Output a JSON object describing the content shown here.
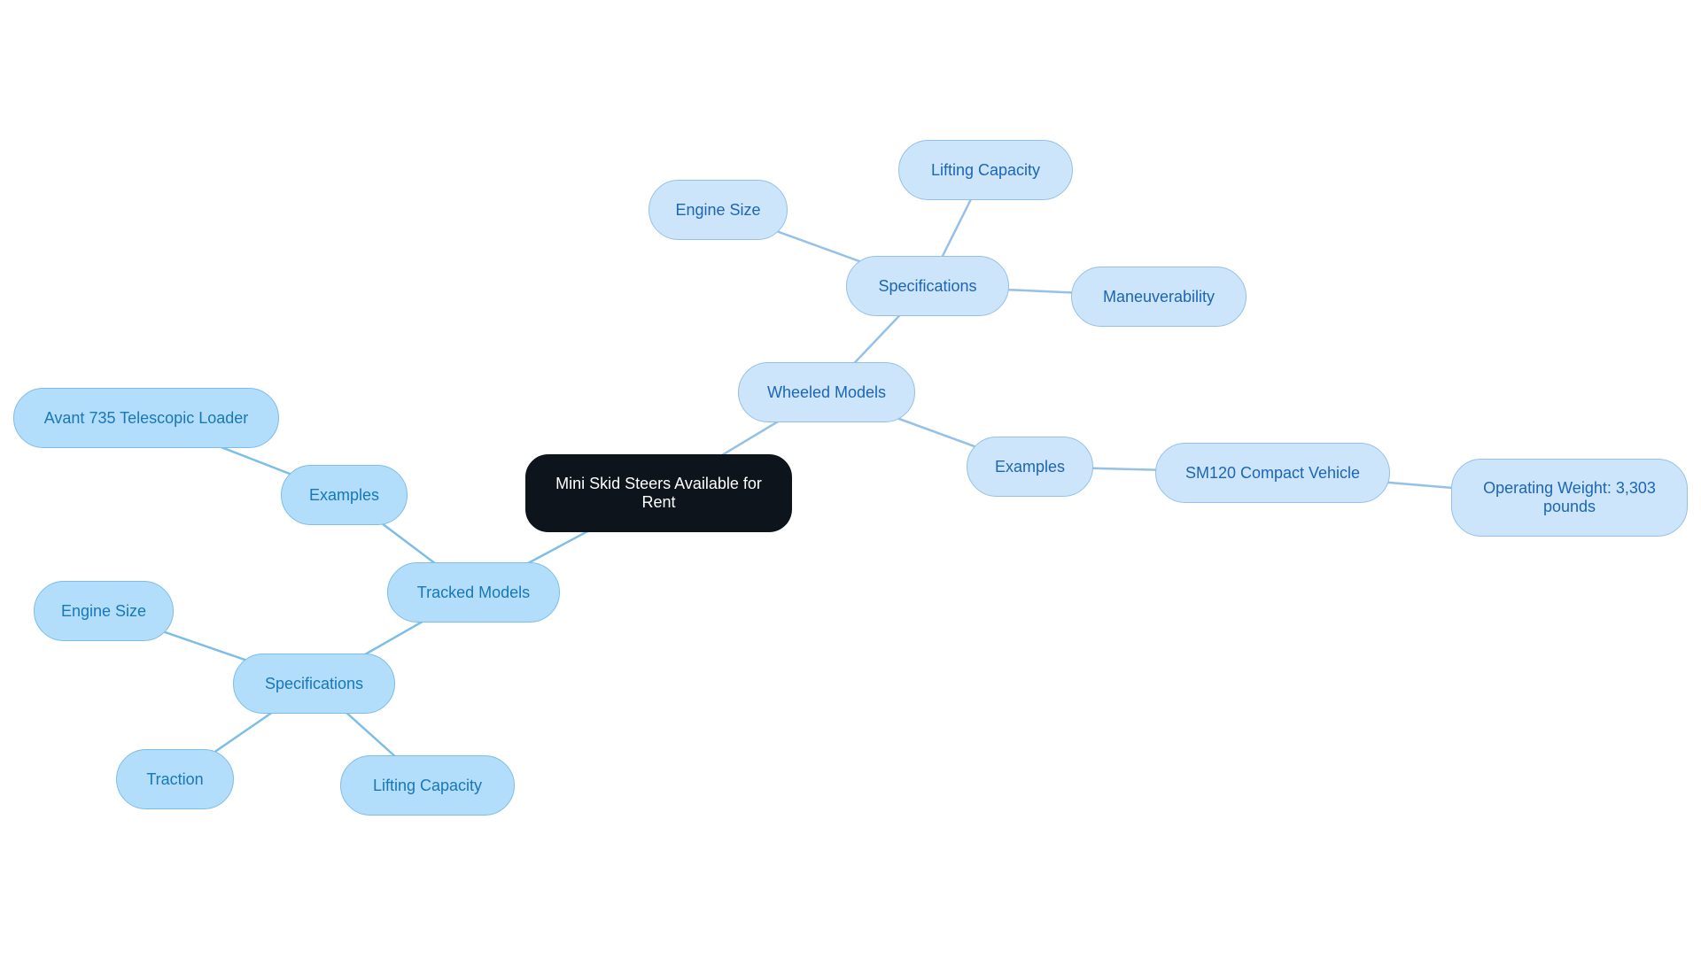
{
  "diagram": {
    "type": "mind-map",
    "colors": {
      "root_fill": "#0d141b",
      "root_text": "#ffffff",
      "wheeled_fill": "#cde5fb",
      "wheeled_text": "#1c66b4",
      "wheeled_edge": "#95c0e8",
      "tracked_fill": "#b3defb",
      "tracked_text": "#1877b6",
      "tracked_edge": "#7dbde6"
    },
    "root": {
      "label": "Mini Skid Steers Available for Rent"
    },
    "nodes": {
      "wheeled": {
        "label": "Wheeled Models"
      },
      "wheeled_specs": {
        "label": "Specifications"
      },
      "wheeled_engine": {
        "label": "Engine Size"
      },
      "wheeled_lifting": {
        "label": "Lifting Capacity"
      },
      "wheeled_maneuver": {
        "label": "Maneuverability"
      },
      "wheeled_examples": {
        "label": "Examples"
      },
      "sm120": {
        "label": "SM120 Compact Vehicle"
      },
      "sm120_weight": {
        "label": "Operating Weight: 3,303 pounds"
      },
      "tracked": {
        "label": "Tracked Models"
      },
      "tracked_examples": {
        "label": "Examples"
      },
      "avant": {
        "label": "Avant 735 Telescopic Loader"
      },
      "tracked_specs": {
        "label": "Specifications"
      },
      "tracked_engine": {
        "label": "Engine Size"
      },
      "tracked_traction": {
        "label": "Traction"
      },
      "tracked_lifting": {
        "label": "Lifting Capacity"
      }
    },
    "edges": [
      [
        "root",
        "wheeled"
      ],
      [
        "wheeled",
        "wheeled_specs"
      ],
      [
        "wheeled_specs",
        "wheeled_engine"
      ],
      [
        "wheeled_specs",
        "wheeled_lifting"
      ],
      [
        "wheeled_specs",
        "wheeled_maneuver"
      ],
      [
        "wheeled",
        "wheeled_examples"
      ],
      [
        "wheeled_examples",
        "sm120"
      ],
      [
        "sm120",
        "sm120_weight"
      ],
      [
        "root",
        "tracked"
      ],
      [
        "tracked",
        "tracked_examples"
      ],
      [
        "tracked_examples",
        "avant"
      ],
      [
        "tracked",
        "tracked_specs"
      ],
      [
        "tracked_specs",
        "tracked_engine"
      ],
      [
        "tracked_specs",
        "tracked_traction"
      ],
      [
        "tracked_specs",
        "tracked_lifting"
      ]
    ]
  }
}
